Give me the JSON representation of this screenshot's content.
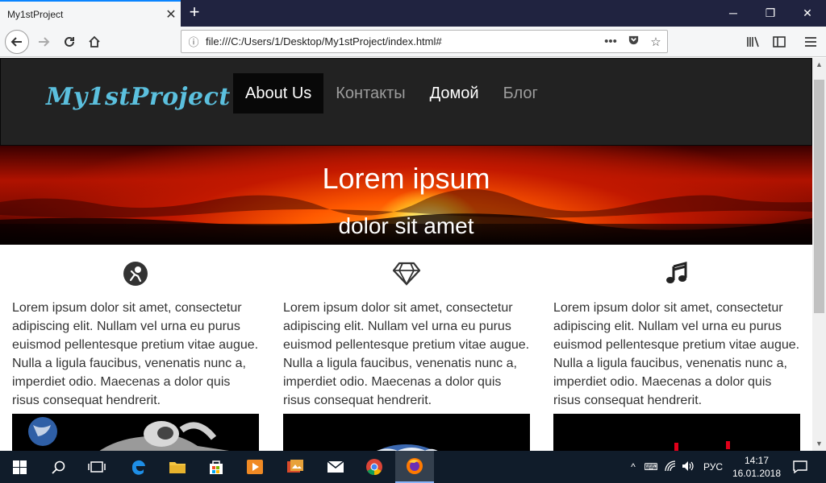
{
  "browser": {
    "tab_title": "My1stProject",
    "tab_close": "✕",
    "new_tab": "+",
    "url": "file:///C:/Users/1/Desktop/My1stProject/index.html#",
    "window_controls": [
      "─",
      "❐",
      "✕"
    ]
  },
  "site": {
    "brand": "My1stProject",
    "brand_star": "☆",
    "nav": [
      {
        "label": "About Us",
        "state": "active"
      },
      {
        "label": "Контакты",
        "state": "normal"
      },
      {
        "label": "Домой",
        "state": "bright"
      },
      {
        "label": "Блог",
        "state": "normal"
      }
    ],
    "hero": {
      "title": "Lorem ipsum",
      "subtitle": "dolor sit amet"
    },
    "columns": [
      {
        "icon": "astronaut-icon",
        "text": "Lorem ipsum dolor sit amet, consectetur adipiscing elit. Nullam vel urna eu purus euismod pellentesque pretium vitae augue. Nulla a ligula faucibus, venenatis nunc a, imperdiet odio. Maecenas a dolor quis risus consequat hendrerit."
      },
      {
        "icon": "diamond-icon",
        "text": "Lorem ipsum dolor sit amet, consectetur adipiscing elit. Nullam vel urna eu purus euismod pellentesque pretium vitae augue. Nulla a ligula faucibus, venenatis nunc a, imperdiet odio. Maecenas a dolor quis risus consequat hendrerit."
      },
      {
        "icon": "music-note-icon",
        "text": "Lorem ipsum dolor sit amet, consectetur adipiscing elit. Nullam vel urna eu purus euismod pellentesque pretium vitae augue. Nulla a ligula faucibus, venenatis nunc a, imperdiet odio. Maecenas a dolor quis risus consequat hendrerit."
      }
    ]
  },
  "taskbar": {
    "language": "РУС",
    "time": "14:17",
    "date": "16.01.2018"
  },
  "colors": {
    "brand": "#5bc0de",
    "navbar": "#222222",
    "taskbar": "#101c2a",
    "accent": "#0a84ff"
  }
}
